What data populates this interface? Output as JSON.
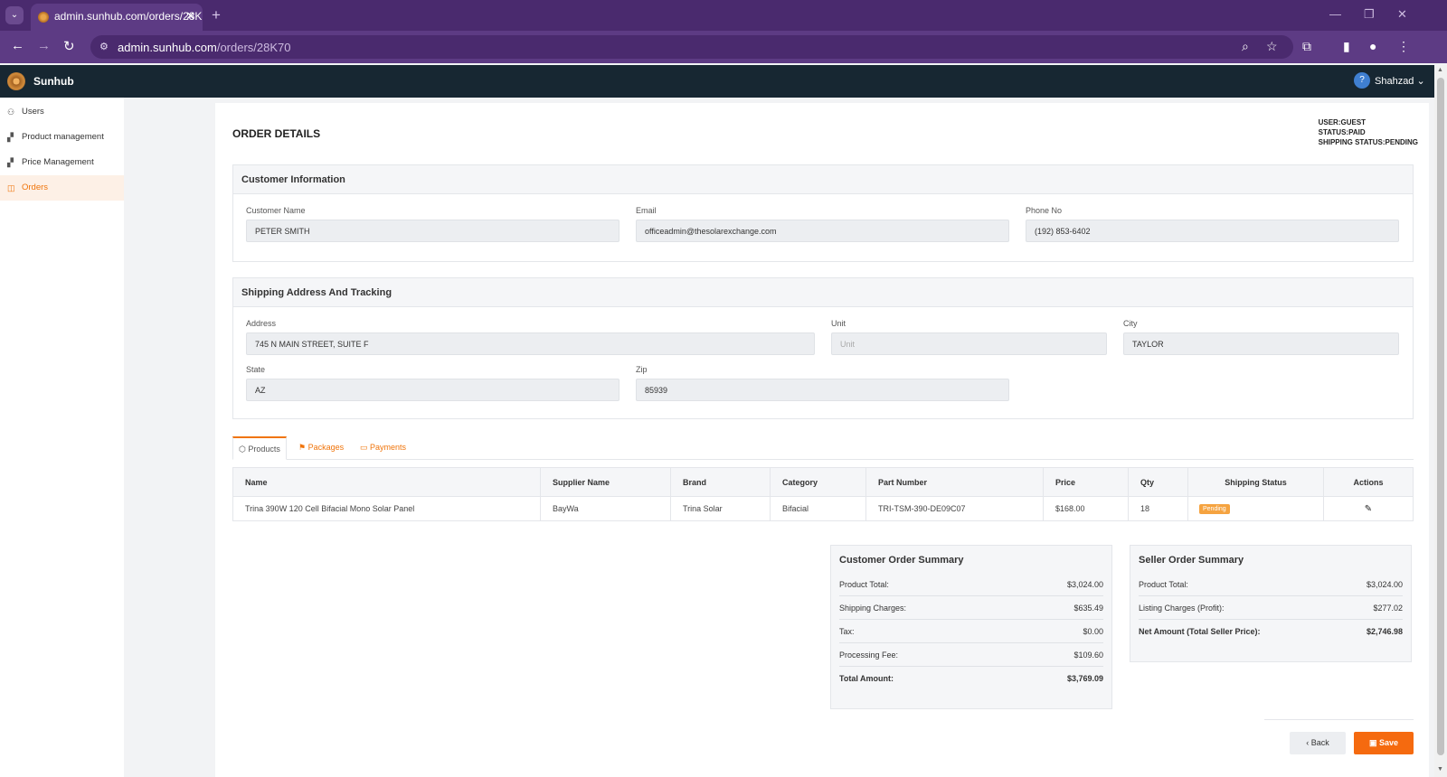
{
  "browser": {
    "tab_title": "admin.sunhub.com/orders/28K",
    "url_host": "admin.sunhub.com",
    "url_path": "/orders/28K70"
  },
  "app": {
    "brand": "Sunhub",
    "user_initial": "?",
    "user_name": "Shahzad"
  },
  "sidebar": {
    "items": [
      {
        "label": "Users",
        "icon": "users-icon"
      },
      {
        "label": "Product management",
        "icon": "boxes-icon"
      },
      {
        "label": "Price Management",
        "icon": "boxes-icon"
      },
      {
        "label": "Orders",
        "icon": "bag-icon",
        "active": true
      }
    ]
  },
  "order": {
    "title": "ORDER DETAILS",
    "user_line": "USER:GUEST",
    "status_line": "STATUS:PAID",
    "shipping_line": "SHIPPING STATUS:PENDING"
  },
  "customer": {
    "heading": "Customer Information",
    "name_label": "Customer Name",
    "name_value": "PETER SMITH",
    "email_label": "Email",
    "email_value": "officeadmin@thesolarexchange.com",
    "phone_label": "Phone No",
    "phone_value": "(192) 853-6402"
  },
  "shipping": {
    "heading": "Shipping Address And Tracking",
    "address_label": "Address",
    "address_value": "745 N MAIN STREET, SUITE F",
    "unit_label": "Unit",
    "unit_placeholder": "Unit",
    "city_label": "City",
    "city_value": "TAYLOR",
    "state_label": "State",
    "state_value": "AZ",
    "zip_label": "Zip",
    "zip_value": "85939"
  },
  "tabs": {
    "products": "Products",
    "packages": "Packages",
    "payments": "Payments"
  },
  "table": {
    "headers": [
      "Name",
      "Supplier Name",
      "Brand",
      "Category",
      "Part Number",
      "Price",
      "Qty",
      "Shipping Status",
      "Actions"
    ],
    "row": {
      "name": "Trina 390W 120 Cell Bifacial Mono Solar Panel",
      "supplier": "BayWa",
      "brand": "Trina Solar",
      "category": "Bifacial",
      "part_number": "TRI-TSM-390-DE09C07",
      "price": "$168.00",
      "qty": "18",
      "shipping_status": "Pending"
    }
  },
  "customer_summary": {
    "title": "Customer Order Summary",
    "rows": [
      {
        "label": "Product Total:",
        "value": "$3,024.00"
      },
      {
        "label": "Shipping Charges:",
        "value": "$635.49"
      },
      {
        "label": "Tax:",
        "value": "$0.00"
      },
      {
        "label": "Processing Fee:",
        "value": "$109.60"
      },
      {
        "label": "Total Amount:",
        "value": "$3,769.09"
      }
    ]
  },
  "seller_summary": {
    "title": "Seller Order Summary",
    "rows": [
      {
        "label": "Product Total:",
        "value": "$3,024.00"
      },
      {
        "label": "Listing Charges (Profit):",
        "value": "$277.02"
      },
      {
        "label": "Net Amount (Total Seller Price):",
        "value": "$2,746.98"
      }
    ]
  },
  "actions": {
    "back": "Back",
    "save": "Save"
  },
  "colors": {
    "accent": "#f0740a",
    "header_bg": "#172732",
    "browser_bg": "#5d3b84"
  }
}
